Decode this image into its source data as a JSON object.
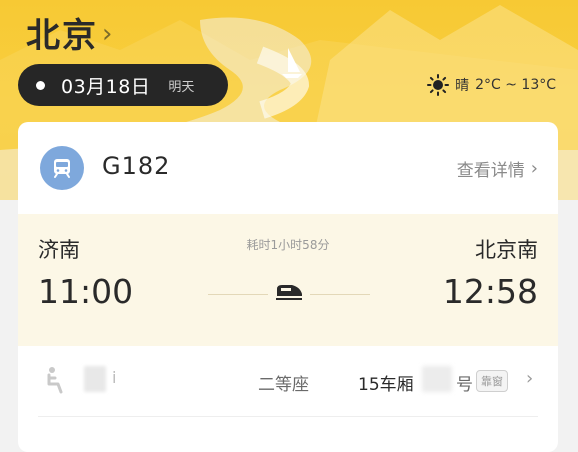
{
  "header": {
    "city": "北京",
    "chevron": "›"
  },
  "date": {
    "text": "03月18日",
    "relative": "明天"
  },
  "weather": {
    "icon": "sun-icon",
    "condition": "晴",
    "range": "2°C ~ 13°C"
  },
  "ticket": {
    "train_number": "G182",
    "details_label": "查看详情",
    "details_chevron": "›",
    "from_station": "济南",
    "from_time": "11:00",
    "to_station": "北京南",
    "to_time": "12:58",
    "duration": "耗时1小时58分"
  },
  "seat": {
    "obscured_text": "i",
    "class": "二等座",
    "carriage": "15车厢",
    "seat_char": "号",
    "tag": "靠窗",
    "chevron": "›"
  },
  "colors": {
    "hero_yellow": "#f7c934",
    "pill_dark": "#262626",
    "route_bg": "#fcf7e6",
    "train_icon_blue": "#7ea8dc"
  }
}
